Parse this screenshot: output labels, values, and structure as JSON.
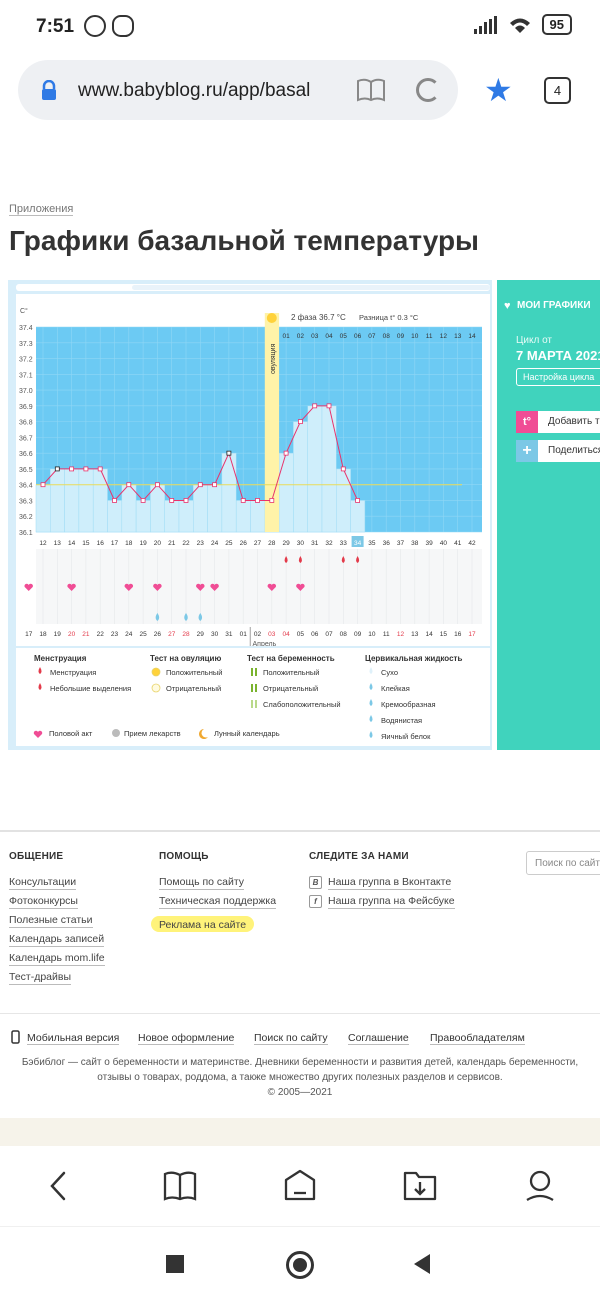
{
  "status_bar": {
    "time": "7:51",
    "battery": "95"
  },
  "browser": {
    "url": "www.babyblog.ru/app/basal",
    "tab_count": "4"
  },
  "breadcrumb": "Приложения",
  "page_title": "Графики базальной температуры",
  "chart": {
    "unit_label": "C°",
    "phase_text": "2 фаза 36.7 °C",
    "diff_text": "Разница t° 0.3 °C",
    "ovulation_label": "овуляция",
    "month_label": "Апрель",
    "top_days": [
      "01",
      "02",
      "03",
      "04",
      "05",
      "06",
      "07",
      "08",
      "09",
      "10",
      "11",
      "12",
      "13",
      "14"
    ],
    "cycle_days": [
      "12",
      "13",
      "14",
      "15",
      "16",
      "17",
      "18",
      "19",
      "20",
      "21",
      "22",
      "23",
      "24",
      "25",
      "26",
      "27",
      "28",
      "29",
      "30",
      "31",
      "32",
      "33",
      "34",
      "35",
      "36",
      "37",
      "38",
      "39",
      "40",
      "41",
      "42"
    ],
    "calendar_dates": [
      "17",
      "18",
      "19",
      "20",
      "21",
      "22",
      "23",
      "24",
      "25",
      "26",
      "27",
      "28",
      "29",
      "30",
      "31",
      "01",
      "02",
      "03",
      "04",
      "05",
      "06",
      "07",
      "08",
      "09",
      "10",
      "11",
      "12",
      "13",
      "14",
      "15",
      "16",
      "17"
    ],
    "red_date_indices": [
      3,
      4,
      10,
      11,
      17,
      18,
      26,
      31
    ],
    "today_cycle_day": "34",
    "today_date": "09"
  },
  "chart_data": {
    "type": "line",
    "title": "",
    "xlabel": "",
    "ylabel": "C°",
    "ylim": [
      36.1,
      37.4
    ],
    "yticks": [
      "37.4",
      "37.3",
      "37.2",
      "37.1",
      "37.0",
      "36.9",
      "36.8",
      "36.7",
      "36.6",
      "36.5",
      "36.4",
      "36.3",
      "36.2",
      "36.1"
    ],
    "x": [
      12,
      13,
      14,
      15,
      16,
      17,
      18,
      19,
      20,
      21,
      22,
      23,
      24,
      25,
      26,
      27,
      28,
      29,
      30,
      31,
      32,
      33,
      34
    ],
    "series": [
      {
        "name": "",
        "values": [
          36.4,
          36.5,
          36.5,
          36.5,
          36.5,
          36.3,
          36.4,
          36.3,
          36.4,
          36.3,
          36.3,
          36.4,
          36.4,
          36.6,
          36.3,
          36.3,
          36.3,
          36.6,
          36.8,
          36.9,
          36.9,
          36.5,
          36.3
        ]
      }
    ],
    "ovulation_day": 28,
    "grid": true
  },
  "legend": {
    "menstruation": {
      "title": "Менструация",
      "items": [
        "Менструация",
        "Небольшие выделения"
      ]
    },
    "ovulation_test": {
      "title": "Тест на овуляцию",
      "items": [
        "Положительный",
        "Отрицательный"
      ]
    },
    "pregnancy_test": {
      "title": "Тест на беременность",
      "items": [
        "Положительный",
        "Отрицательный",
        "Слабоположительный"
      ]
    },
    "cervical": {
      "title": "Цервикальная жидкость",
      "items": [
        "Сухо",
        "Клейкая",
        "Кремообразная",
        "Водянистая",
        "Яичный белок"
      ]
    },
    "bottom": [
      "Половой акт",
      "Прием лекарств",
      "Лунный календарь"
    ]
  },
  "side_panel": {
    "title": "МОИ ГРАФИКИ",
    "cycle_label": "Цикл от",
    "cycle_date": "7 МАРТА 2021",
    "settings_btn": "Настройка цикла",
    "add_label": "Добавить т",
    "share_label": "Поделиться"
  },
  "footer": {
    "col1": {
      "title": "ОБЩЕНИЕ",
      "links": [
        "Консультации",
        "Фотоконкурсы",
        "Полезные статьи",
        "Календарь записей",
        "Календарь mom.life",
        "Тест-драйвы"
      ]
    },
    "col2": {
      "title": "ПОМОЩЬ",
      "links": [
        "Помощь по сайту",
        "Техническая поддержка",
        "Реклама на сайте"
      ]
    },
    "col3": {
      "title": "СЛЕДИТЕ ЗА НАМИ",
      "links": [
        "Наша группа в Вконтакте",
        "Наша группа на Фейсбуке"
      ]
    },
    "search_placeholder": "Поиск по сайту",
    "nav": [
      "Мобильная версия",
      "Новое оформление",
      "Поиск по сайту",
      "Соглашение",
      "Правообладателям"
    ],
    "about_line1": "Бэбиблог — сайт о беременности и материнстве. Дневники беременности и развития детей, календарь беременности,",
    "about_line2": "отзывы о товарах, роддома, а также множество других полезных разделов и сервисов.",
    "copyright": "© 2005—2021"
  }
}
